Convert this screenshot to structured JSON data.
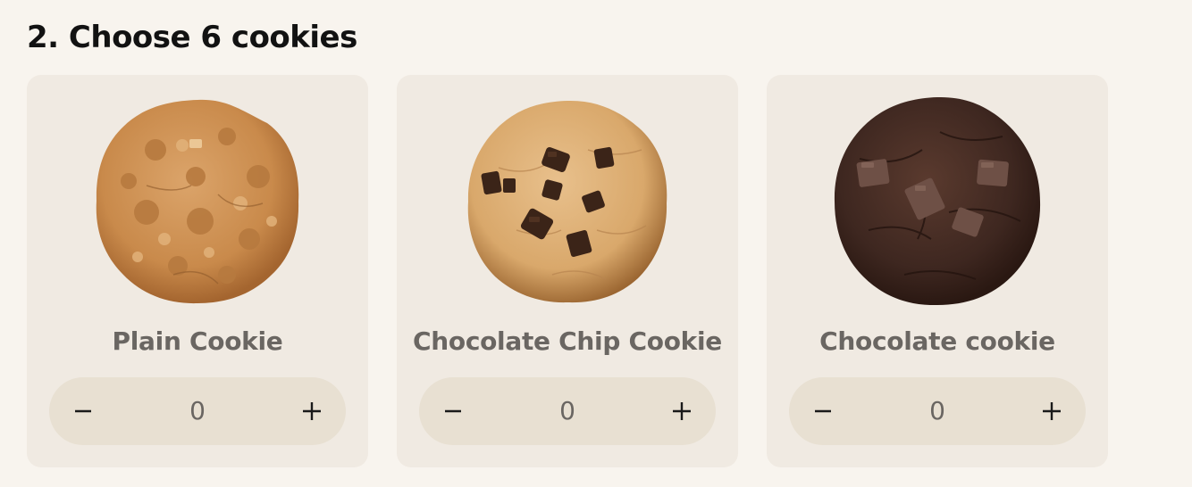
{
  "section": {
    "title": "2. Choose 6 cookies"
  },
  "products": [
    {
      "name": "Plain Cookie",
      "quantity": "0",
      "image_icon": "plain-cookie-image",
      "colors": {
        "base": "#c98a4b",
        "edge": "#a4652f",
        "light": "#dba46a",
        "chunk": "#6b4a2b"
      }
    },
    {
      "name": "Chocolate Chip Cookie",
      "quantity": "0",
      "image_icon": "chocolate-chip-cookie-image",
      "colors": {
        "base": "#d9a86b",
        "edge": "#9c6732",
        "light": "#e8c08c",
        "chunk": "#3b2418"
      }
    },
    {
      "name": "Chocolate cookie",
      "quantity": "0",
      "image_icon": "chocolate-cookie-image",
      "colors": {
        "base": "#3e2720",
        "edge": "#2a1812",
        "light": "#5a3a2e",
        "chunk": "#6e5046"
      }
    }
  ],
  "controls": {
    "decrease_icon": "minus-icon",
    "increase_icon": "plus-icon"
  }
}
